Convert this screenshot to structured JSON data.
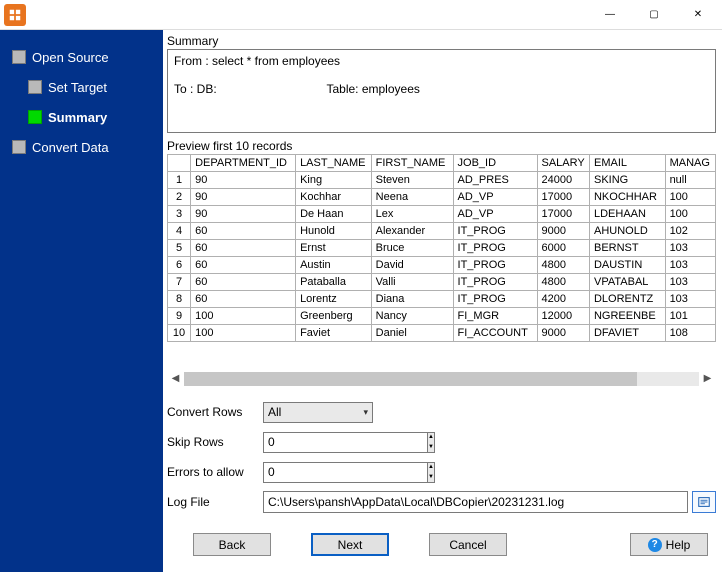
{
  "titlebar": {
    "minimize": "—",
    "maximize": "▢",
    "close": "✕"
  },
  "sidebar": {
    "items": [
      {
        "label": "Open Source",
        "active": false,
        "child": false
      },
      {
        "label": "Set Target",
        "active": false,
        "child": true
      },
      {
        "label": "Summary",
        "active": true,
        "child": true
      },
      {
        "label": "Convert Data",
        "active": false,
        "child": false
      }
    ]
  },
  "summary": {
    "heading": "Summary",
    "text": "From : select * from employees\n\nTo : DB:                                 Table: employees"
  },
  "preview": {
    "heading": "Preview first 10 records",
    "columns": [
      "DEPARTMENT_ID",
      "LAST_NAME",
      "FIRST_NAME",
      "JOB_ID",
      "SALARY",
      "EMAIL",
      "MANAG"
    ],
    "rows": [
      [
        "90",
        "King",
        "Steven",
        "AD_PRES",
        "24000",
        "SKING",
        "null"
      ],
      [
        "90",
        "Kochhar",
        "Neena",
        "AD_VP",
        "17000",
        "NKOCHHAR",
        "100"
      ],
      [
        "90",
        "De Haan",
        "Lex",
        "AD_VP",
        "17000",
        "LDEHAAN",
        "100"
      ],
      [
        "60",
        "Hunold",
        "Alexander",
        "IT_PROG",
        "9000",
        "AHUNOLD",
        "102"
      ],
      [
        "60",
        "Ernst",
        "Bruce",
        "IT_PROG",
        "6000",
        "BERNST",
        "103"
      ],
      [
        "60",
        "Austin",
        "David",
        "IT_PROG",
        "4800",
        "DAUSTIN",
        "103"
      ],
      [
        "60",
        "Pataballa",
        "Valli",
        "IT_PROG",
        "4800",
        "VPATABAL",
        "103"
      ],
      [
        "60",
        "Lorentz",
        "Diana",
        "IT_PROG",
        "4200",
        "DLORENTZ",
        "103"
      ],
      [
        "100",
        "Greenberg",
        "Nancy",
        "FI_MGR",
        "12000",
        "NGREENBE",
        "101"
      ],
      [
        "100",
        "Faviet",
        "Daniel",
        "FI_ACCOUNT",
        "9000",
        "DFAVIET",
        "108"
      ]
    ]
  },
  "form": {
    "convert_rows_label": "Convert Rows",
    "convert_rows_value": "All",
    "skip_rows_label": "Skip Rows",
    "skip_rows_value": "0",
    "errors_label": "Errors to allow",
    "errors_value": "0",
    "logfile_label": "Log File",
    "logfile_value": "C:\\Users\\pansh\\AppData\\Local\\DBCopier\\20231231.log"
  },
  "buttons": {
    "back": "Back",
    "next": "Next",
    "cancel": "Cancel",
    "help": "Help"
  }
}
